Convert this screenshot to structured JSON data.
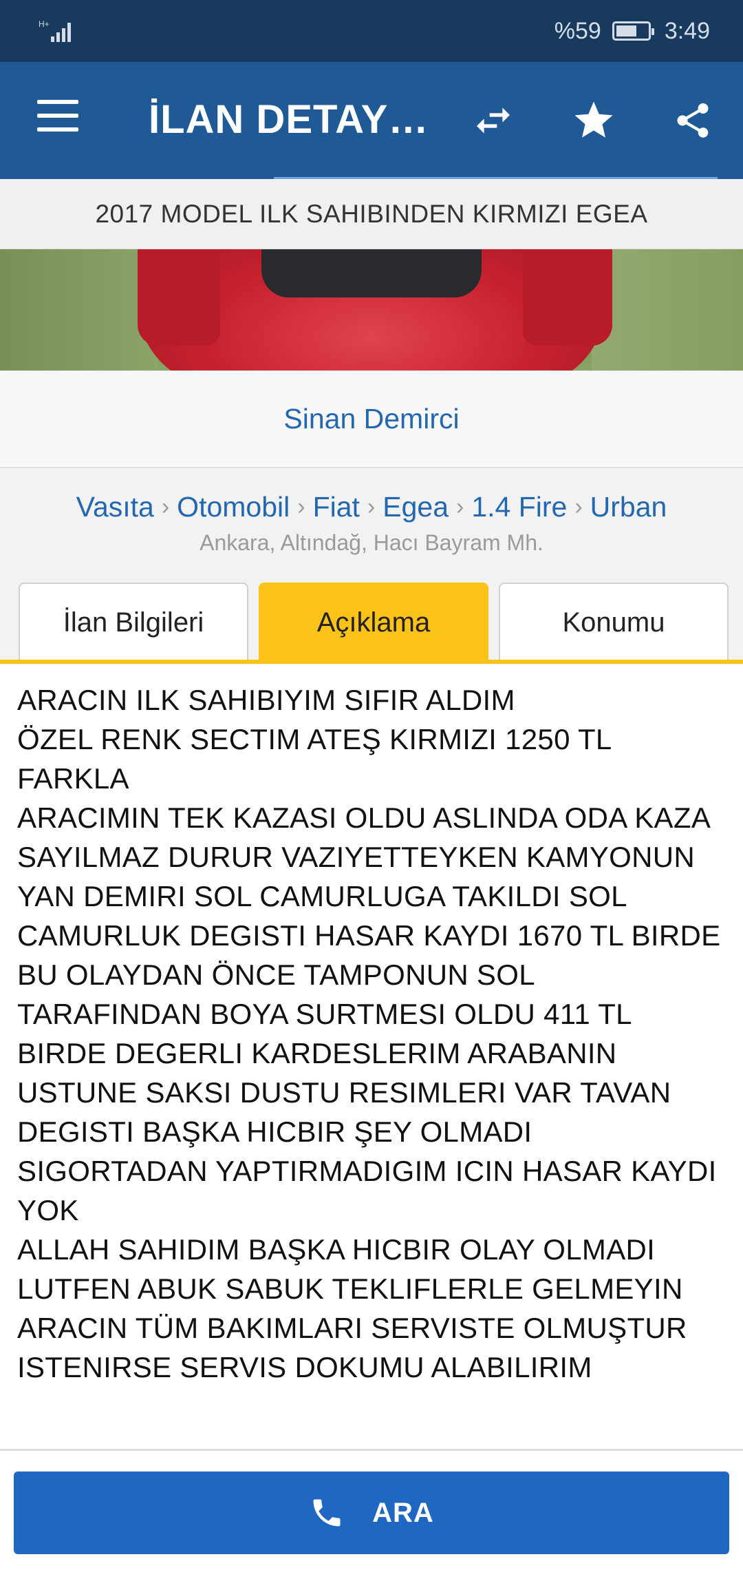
{
  "status_bar": {
    "battery_percent": "%59",
    "battery_level": 0.59,
    "time": "3:49",
    "network_label": "H+"
  },
  "app_bar": {
    "title": "İLAN DETAYL...",
    "icons": [
      "menu-icon",
      "compare-arrows-icon",
      "star-icon",
      "share-icon"
    ]
  },
  "ad": {
    "title": "2017 MODEL ILK SAHIBINDEN KIRMIZI EGEA"
  },
  "seller": {
    "name": "Sinan Demirci"
  },
  "breadcrumb": {
    "items": [
      "Vasıta",
      "Otomobil",
      "Fiat",
      "Egea",
      "1.4 Fire",
      "Urban"
    ],
    "separator": "›"
  },
  "location": "Ankara, Altındağ, Hacı Bayram Mh.",
  "tabs": [
    {
      "label": "İlan Bilgileri",
      "active": false
    },
    {
      "label": "Açıklama",
      "active": true
    },
    {
      "label": "Konumu",
      "active": false
    }
  ],
  "description": {
    "lines": [
      "ARACIN ILK SAHIBIYIM SIFIR ALDIM",
      "ÖZEL RENK SECTIM ATEŞ KIRMIZI 1250 TL FARKLA",
      "ARACIMIN TEK KAZASI OLDU ASLINDA ODA KAZA SAYILMAZ DURUR VAZIYETTEYKEN KAMYONUN YAN DEMIRI SOL CAMURLUGA TAKILDI SOL CAMURLUK DEGISTI HASAR KAYDI 1670 TL BIRDE BU OLAYDAN ÖNCE TAMPONUN SOL TARAFINDAN BOYA SURTMESI OLDU 411 TL",
      "BIRDE DEGERLI KARDESLERIM ARABANIN USTUNE SAKSI DUSTU RESIMLERI VAR TAVAN DEGISTI BAŞKA HICBIR ŞEY OLMADI SIGORTADAN YAPTIRMADIGIM ICIN HASAR KAYDI YOK",
      "ALLAH SAHIDIM BAŞKA HICBIR OLAY OLMADI",
      "LUTFEN ABUK SABUK TEKLIFLERLE GELMEYIN",
      "ARACIN TÜM BAKIMLARI SERVISTE OLMUŞTUR",
      "ISTENIRSE SERVIS DOKUMU ALABILIRIM"
    ]
  },
  "call_button": {
    "label": "ARA",
    "icon": "phone-icon"
  },
  "colors": {
    "status_bar": "#173a5e",
    "app_bar": "#1f5a96",
    "link_blue": "#2367b0",
    "active_tab": "#fbc21a",
    "call_button": "#1f67c0"
  }
}
